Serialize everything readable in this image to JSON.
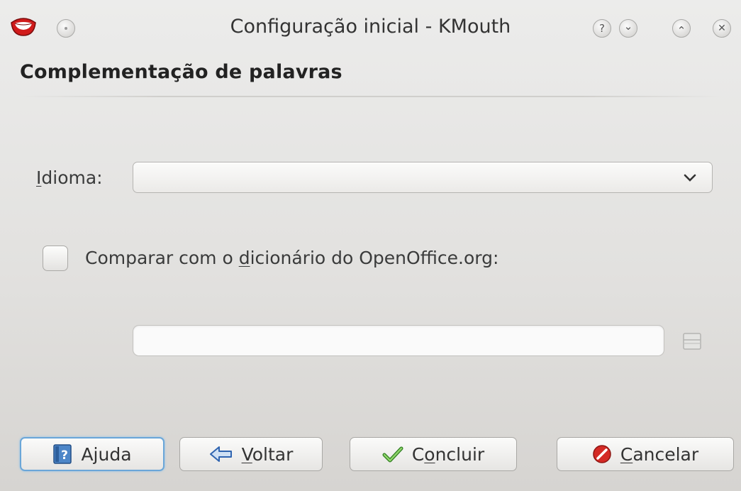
{
  "window": {
    "title": "Configuração inicial - KMouth"
  },
  "titlebar": {
    "app_icon": "kmouth-lips-icon",
    "menu_button": "window-menu-icon",
    "help_glyph": "?",
    "minimize_glyph": "⌄",
    "maximize_glyph": "⌃",
    "close_glyph": "✕"
  },
  "page": {
    "heading": "Complementação de palavras"
  },
  "form": {
    "language": {
      "label_first": "I",
      "label_rest": "dioma:",
      "selected_value": "",
      "arrow_glyph": "⌄"
    },
    "compare": {
      "checked": false,
      "label_before": "Comparar com o ",
      "label_mnemonic": "d",
      "label_after": "icionário do OpenOffice.org:"
    },
    "dictionary_path": {
      "value": "",
      "placeholder": ""
    }
  },
  "buttons": {
    "help": {
      "label": "Ajuda",
      "icon": "help-book-icon"
    },
    "back": {
      "label_mnemonic": "V",
      "label_rest": "oltar",
      "icon": "arrow-left-icon"
    },
    "finish": {
      "label_before": "C",
      "label_mnemonic": "o",
      "label_after": "ncluir",
      "icon": "checkmark-icon"
    },
    "cancel": {
      "label_mnemonic": "C",
      "label_rest": "ancelar",
      "icon": "cancel-icon"
    }
  },
  "colors": {
    "focus_ring": "#6aa6d8",
    "cancel_red": "#d42a25",
    "check_green": "#4aa02c",
    "arrow_blue": "#3a78c8"
  }
}
